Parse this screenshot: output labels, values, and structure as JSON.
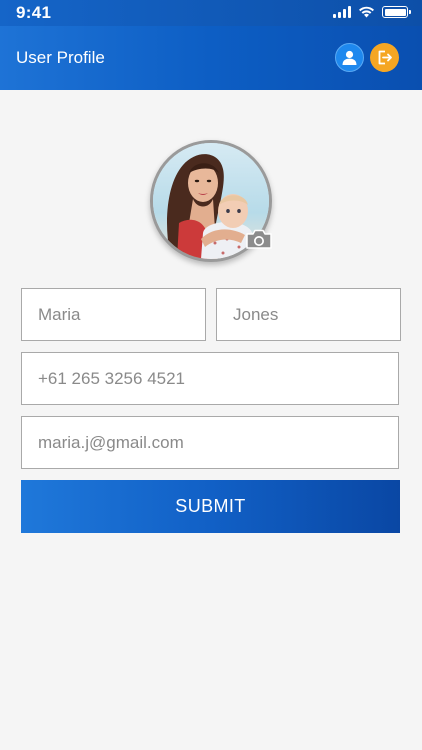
{
  "status_bar": {
    "time": "9:41"
  },
  "header": {
    "title": "User Profile",
    "actions": [
      {
        "icon": "profile-icon",
        "color": "#1e88ee"
      },
      {
        "icon": "logout-icon",
        "color": "#f5a623"
      }
    ]
  },
  "avatar": {
    "icon": "camera-icon"
  },
  "form": {
    "first_name": "Maria",
    "last_name": "Jones",
    "phone": "+61 265 3256 4521",
    "email": "maria.j@gmail.com",
    "submit_label": "SUBMIT"
  },
  "colors": {
    "primary": "#1565c8",
    "primary_dark": "#0a47a4",
    "accent": "#f5a623",
    "background": "#f5f5f5",
    "field_border": "#a9a9a9"
  }
}
